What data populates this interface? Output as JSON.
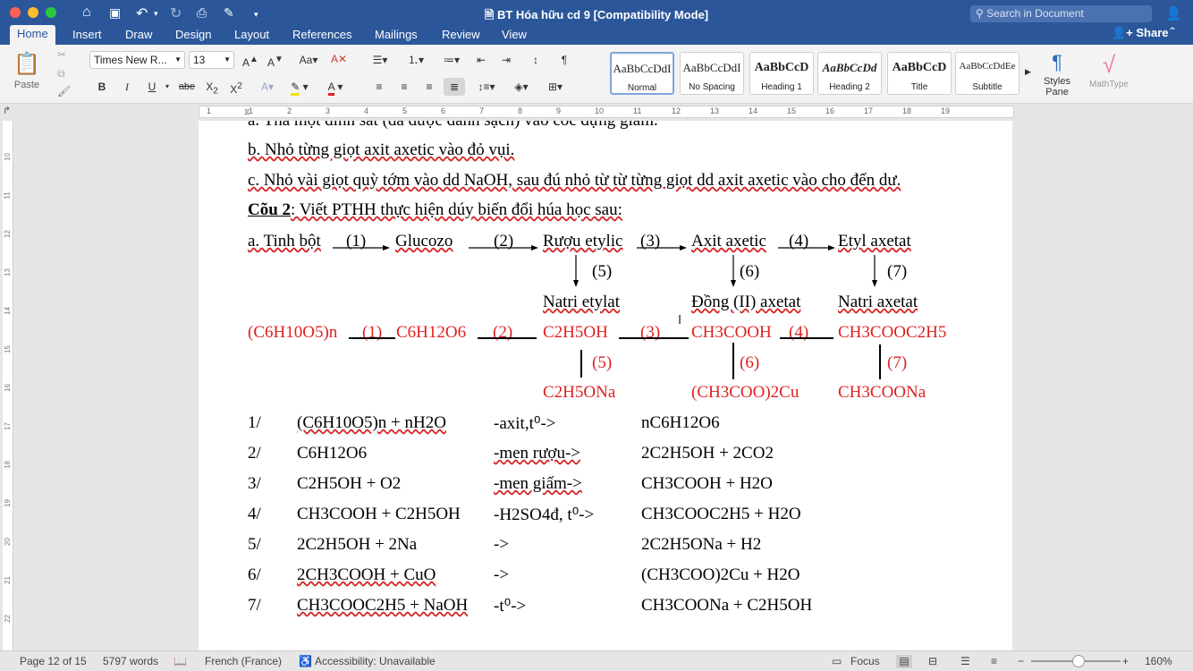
{
  "window": {
    "title": "BT Hóa hữu cd 9 [Compatibility Mode]",
    "search_placeholder": "Search in Document",
    "share_label": "Share",
    "tabs": [
      "Home",
      "Insert",
      "Draw",
      "Design",
      "Layout",
      "References",
      "Mailings",
      "Review",
      "View"
    ]
  },
  "ribbon": {
    "paste_label": "Paste",
    "font_name": "Times New R...",
    "font_size": "13",
    "styles": [
      {
        "preview": "AaBbCcDdI",
        "name": "Normal"
      },
      {
        "preview": "AaBbCcDdI",
        "name": "No Spacing"
      },
      {
        "preview": "AaBbCcD",
        "name": "Heading 1"
      },
      {
        "preview": "AaBbCcDd",
        "name": "Heading 2"
      },
      {
        "preview": "AaBbCcD",
        "name": "Title"
      },
      {
        "preview": "AaBbCcDdEe",
        "name": "Subtitle"
      }
    ],
    "styles_pane_label": "Styles Pane",
    "mathtype_label": "MathType"
  },
  "ruler": {
    "ticks": [
      "1",
      "1",
      "2",
      "3",
      "4",
      "5",
      "6",
      "7",
      "8",
      "9",
      "10",
      "11",
      "12",
      "13",
      "14",
      "15",
      "16",
      "17",
      "18",
      "19"
    ]
  },
  "vruler": {
    "ticks": [
      "10",
      "11",
      "12",
      "13",
      "14",
      "15",
      "16",
      "17",
      "18",
      "19",
      "20",
      "21",
      "22"
    ]
  },
  "document": {
    "line_a_partial": "a. Thả một đinh sắt (đã được đánh sạch) vào cốc đựng giấm.",
    "line_b": "b. Nhỏ từng giọt axit axetic vào đỏ vụi.",
    "line_c": "c. Nhỏ vài giọt quỳ tớm vào dd NaOH, sau đú nhỏ từ từ từng giọt dd axit axetic vào cho đến dư.",
    "q2_label": "Cõu 2",
    "q2_text": ": Viết PTHH thực hiện dúy biến đổi húa học sau:",
    "scheme": {
      "a_label": "a. Tinh bột",
      "glucozo": "Glucozo",
      "ruou": "Rượu etylic",
      "axit": "Axit axetic",
      "etyl": "Etyl axetat",
      "steps": [
        "(1)",
        "(2)",
        "(3)",
        "(4)"
      ],
      "down_steps": [
        "(5)",
        "(6)",
        "(7)"
      ],
      "natri_etylat": "Natri etylat",
      "dong_axetat": "Đồng (II) axetat",
      "natri_axetat": "Natri axetat"
    },
    "red_scheme": {
      "start": "(C6H10O5)n",
      "c6": "C6H12O6",
      "c2h5oh": "C2H5OH",
      "ch3cooh": "CH3COOH",
      "ester": "CH3COOC2H5",
      "steps": [
        "(1)",
        "(2)",
        "(3)",
        "(4)"
      ],
      "down_steps": [
        "(5)",
        "(6)",
        "(7)"
      ],
      "c2h5ona": "C2H5ONa",
      "cu_salt": "(CH3COO)2Cu",
      "ch3coona": "CH3COONa"
    },
    "reactions": [
      {
        "num": "1/",
        "left": "(C6H10O5)n + nH2O",
        "cond": "-axit,t⁰->",
        "right": "nC6H12O6"
      },
      {
        "num": "2/",
        "left": "C6H12O6",
        "cond": "-men rượu->",
        "right": "2C2H5OH + 2CO2"
      },
      {
        "num": "3/",
        "left": "C2H5OH + O2",
        "cond": "-men giấm->",
        "right": "CH3COOH + H2O"
      },
      {
        "num": "4/",
        "left": "CH3COOH + C2H5OH",
        "cond": "-H2SO4đ, t⁰->",
        "right": "CH3COOC2H5 + H2O"
      },
      {
        "num": "5/",
        "left": "2C2H5OH + 2Na",
        "cond": "->",
        "right": "2C2H5ONa + H2"
      },
      {
        "num": "6/",
        "left": "2CH3COOH + CuO",
        "cond": "->",
        "right": "(CH3COO)2Cu + H2O"
      },
      {
        "num": "7/",
        "left": "CH3COOC2H5 + NaOH",
        "cond": "-t⁰->",
        "right": "CH3COONa + C2H5OH"
      }
    ]
  },
  "status": {
    "page": "Page 12 of 15",
    "words": "5797 words",
    "language": "French (France)",
    "accessibility": "Accessibility: Unavailable",
    "focus": "Focus",
    "zoom": "160%"
  },
  "colors": {
    "accent": "#2b579a",
    "red_text": "#e02020"
  }
}
